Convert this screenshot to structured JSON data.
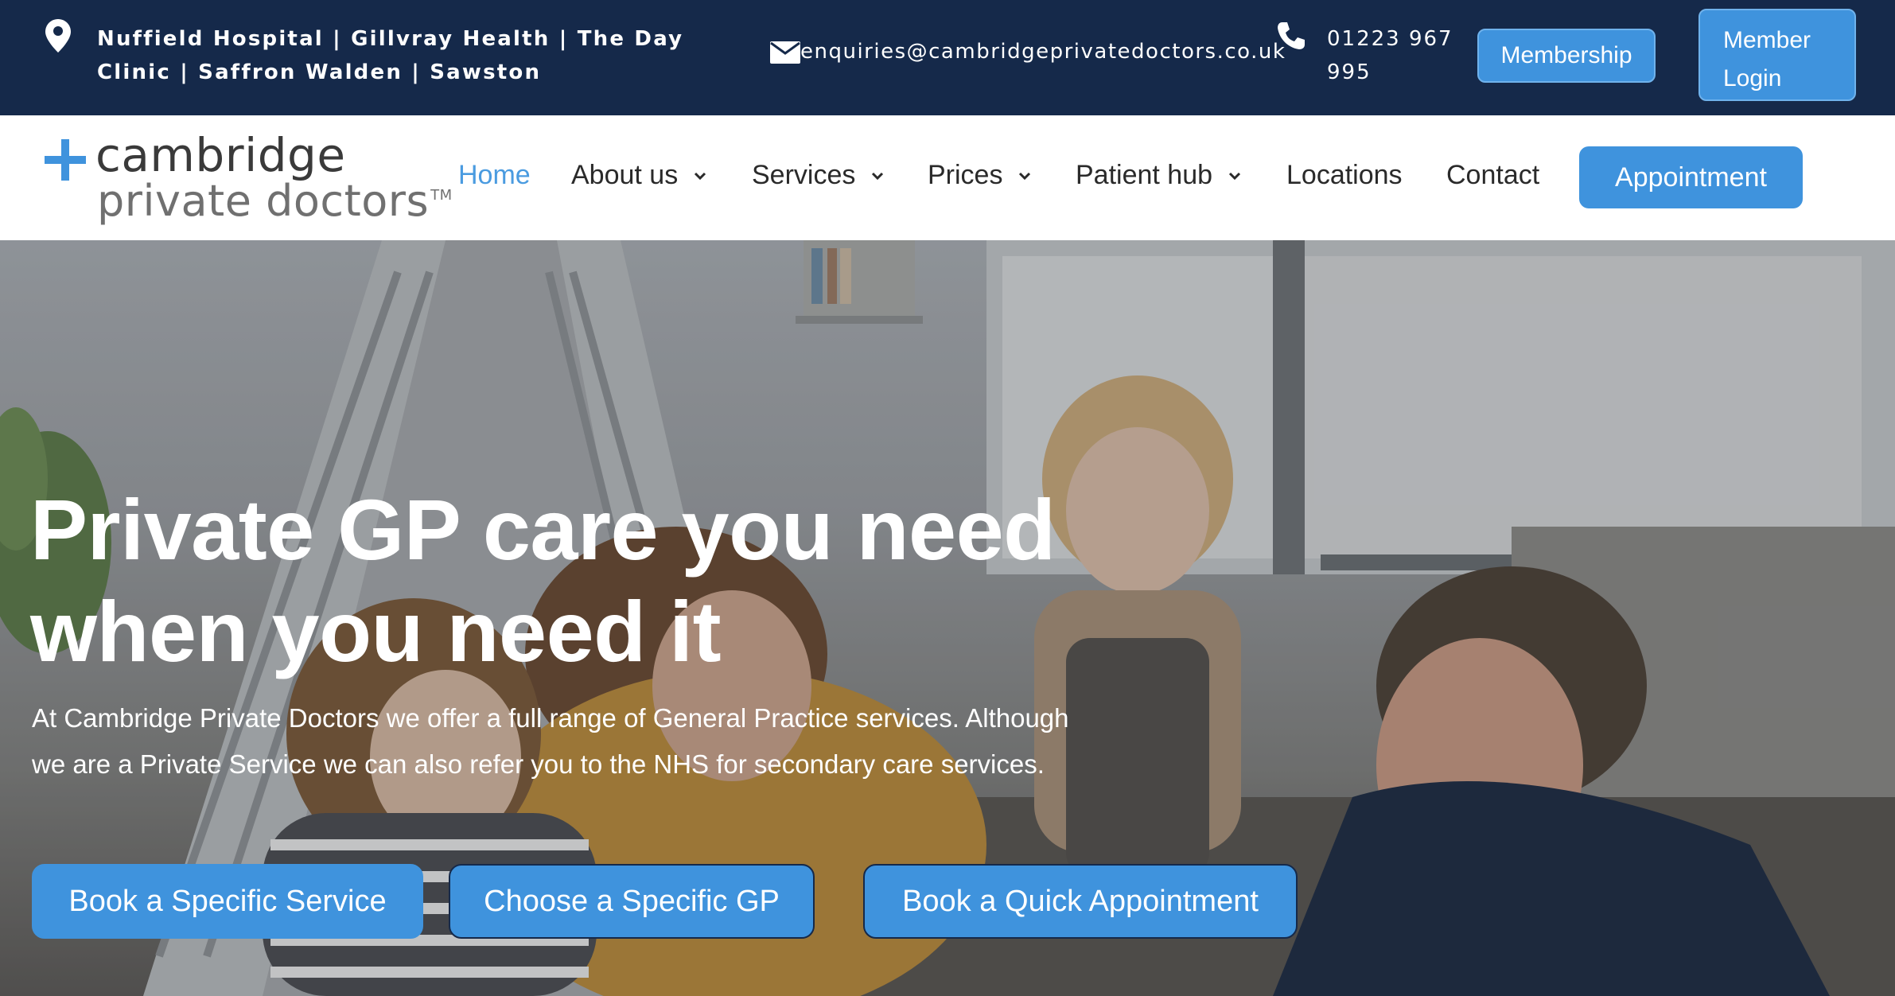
{
  "topbar": {
    "location_icon": "map-pin-icon",
    "locations_text": "Nuffield Hospital | Gillvray Health | The Day Clinic | Saffron Walden | Sawston",
    "email_icon": "envelope-icon",
    "email": "enquiries@cambridgeprivatedoctors.co.uk",
    "phone_icon": "phone-icon",
    "phone": "01223 967 995",
    "membership_label": "Membership",
    "member_login_label": "Member Login"
  },
  "logo": {
    "line1": "cambridge",
    "line2": "private doctors",
    "tm": "TM"
  },
  "nav": {
    "items": [
      {
        "label": "Home",
        "active": true
      },
      {
        "label": "About us",
        "has_dropdown": true
      },
      {
        "label": "Services",
        "has_dropdown": true
      },
      {
        "label": "Prices",
        "has_dropdown": true
      },
      {
        "label": "Patient hub",
        "has_dropdown": true
      },
      {
        "label": "Locations"
      },
      {
        "label": "Contact"
      }
    ],
    "appointment_label": "Appointment"
  },
  "hero": {
    "title": "Private GP care you need when you need it",
    "description": "At Cambridge Private Doctors we offer a full range of General Practice services. Although we are a Private Service we can also refer you to the NHS for secondary care services.",
    "buttons": [
      "Book a Specific Service",
      "Choose a Specific GP",
      "Book a Quick Appointment"
    ]
  },
  "colors": {
    "topbar_bg": "#15294a",
    "accent": "#3f93dd",
    "nav_active": "#4a9be0"
  }
}
